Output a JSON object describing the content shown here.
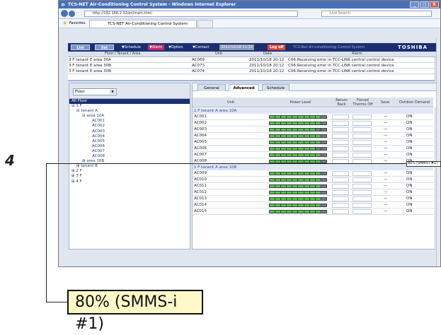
{
  "browser": {
    "title": "TCS-NET Air-Conditioning Control System - Windows Internet Explorer",
    "address": "http://192.168.2.32/en/main.html",
    "live_search": "Live Search",
    "favorites": "Favorites",
    "page_tab": "TCS-NET Air-Conditioning Control System",
    "window_buttons": [
      "_",
      "□",
      "X"
    ]
  },
  "menubar": {
    "list": "List",
    "set": "Set",
    "schedule": "▼Schedule",
    "alarm": "▼Alarm",
    "option": "▼Option",
    "contact": "▼Contact",
    "datetime": "2011/10/18 11:33",
    "logoff": "Log off",
    "system": "TCS-Net Air-conditioning Control System",
    "brand": "TOSHIBA"
  },
  "alarms": {
    "headers": [
      "Floor / Tenant / Area",
      "Unit",
      "Date",
      "Alarm"
    ],
    "rows": [
      [
        "3 F tenant E area 30A",
        "AC069",
        "2011/10/18 20:12",
        "C06:Receiving error in TCC-LINK central control device"
      ],
      [
        "3 F tenant E area 30B",
        "AC073",
        "2011/10/18 20:12",
        "C06:Receiving error in TCC-LINK central control device"
      ],
      [
        "3 F tenant E area 30B",
        "AC074",
        "2011/10/18 20:12",
        "C06:Receiving error in TCC-LINK central control device"
      ]
    ]
  },
  "tree": {
    "filter": "Floor",
    "items": [
      "All Floor",
      "⊟ 1 F",
      "⊟ tenant A",
      "⊟ area 10A",
      "AC001",
      "AC002",
      "AC003",
      "AC004",
      "AC005",
      "AC006",
      "AC007",
      "AC008",
      "⊞ area 10B",
      "⊞ tenant B",
      "⊞ 2 F",
      "⊞ 3 F",
      "⊞ 4 F"
    ]
  },
  "tabs": [
    "General",
    "Advanced",
    "Schedule"
  ],
  "columns": [
    "Unit",
    "Power Level",
    "Return Back",
    "Forced Thermo Off",
    "Save",
    "Outdoor Demand"
  ],
  "groups": [
    "1 F tenant A area 10A",
    "1 F tenant A area 10B"
  ],
  "units": [
    {
      "unit": "AC001",
      "power_level": 0.9,
      "save": "—",
      "outdoor": "ON"
    },
    {
      "unit": "AC002",
      "power_level": 0.9,
      "save": "—",
      "outdoor": "ON"
    },
    {
      "unit": "AC003",
      "power_level": 0.8,
      "save": "—",
      "outdoor": "ON"
    },
    {
      "unit": "AC004",
      "power_level": 0.9,
      "save": "—",
      "outdoor": "ON"
    },
    {
      "unit": "AC005",
      "power_level": 0.9,
      "save": "—",
      "outdoor": "ON"
    },
    {
      "unit": "AC006",
      "power_level": 0.8,
      "save": "—",
      "outdoor": "ON"
    },
    {
      "unit": "AC007",
      "power_level": 0.9,
      "save": "—",
      "outdoor": "ON"
    },
    {
      "unit": "AC008",
      "power_level": 0.9,
      "save": "—",
      "outdoor": "ON"
    },
    {
      "unit": "AC009",
      "power_level": 0.9,
      "save": "—",
      "outdoor": "ON"
    },
    {
      "unit": "AC010",
      "power_level": 0.9,
      "save": "—",
      "outdoor": "ON"
    },
    {
      "unit": "AC011",
      "power_level": 0.9,
      "save": "—",
      "outdoor": "ON"
    },
    {
      "unit": "AC012",
      "power_level": 0.9,
      "save": "—",
      "outdoor": "ON"
    },
    {
      "unit": "AC013",
      "power_level": 0.9,
      "save": "—",
      "outdoor": "ON"
    },
    {
      "unit": "AC014",
      "power_level": 0.9,
      "save": "—",
      "outdoor": "ON"
    },
    {
      "unit": "AC015",
      "power_level": 0.9,
      "save": "—",
      "outdoor": "ON"
    }
  ],
  "annotation": {
    "number": "4",
    "tooltip": "80% (SMMS-i #1)",
    "callout": "80% (SMMS-i #1)"
  }
}
